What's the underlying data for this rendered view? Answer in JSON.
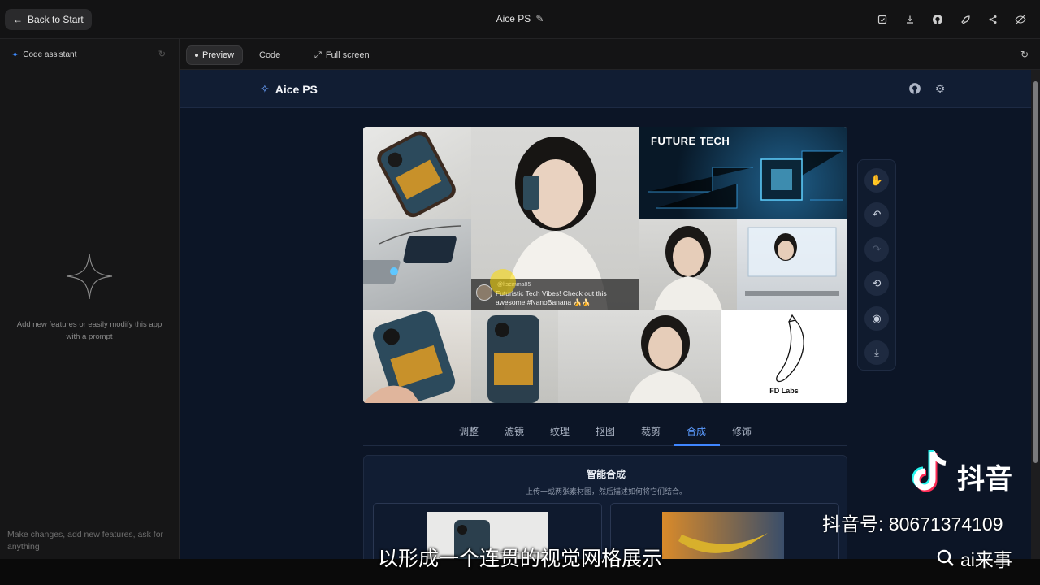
{
  "topbar": {
    "back_label": "Back to Start",
    "title": "Aice PS"
  },
  "sidebar": {
    "header": "Code assistant",
    "hint": "Add new features or easily modify this app with a prompt",
    "prompt_placeholder": "Make changes, add new features, ask for anything"
  },
  "view_tabs": {
    "preview": "Preview",
    "code": "Code",
    "fullscreen": "Full screen"
  },
  "app": {
    "name": "Aice PS",
    "canvas": {
      "banner_text": "FUTURE TECH",
      "caption_handle": "@ltsemma85",
      "caption_text": "Futuristic Tech Vibes! Check out this awesome #NanoBanana 🍌🍌",
      "sketch_label": "FD Labs"
    },
    "edit_tabs": [
      "调整",
      "滤镜",
      "纹理",
      "抠图",
      "裁剪",
      "合成",
      "修饰"
    ],
    "active_tab": "合成",
    "panel": {
      "title": "智能合成",
      "subtitle": "上传一或两张素材图，然后描述如何将它们结合。"
    }
  },
  "overlay": {
    "subtitle": "以形成一个连贯的视觉网格展示",
    "brand": "抖音",
    "account": "抖音号: 80671374109",
    "search": "ai来事"
  },
  "colors": {
    "accent": "#3f86ff",
    "preview_bg": "#0c1526",
    "sidebar_bg": "#161617"
  }
}
